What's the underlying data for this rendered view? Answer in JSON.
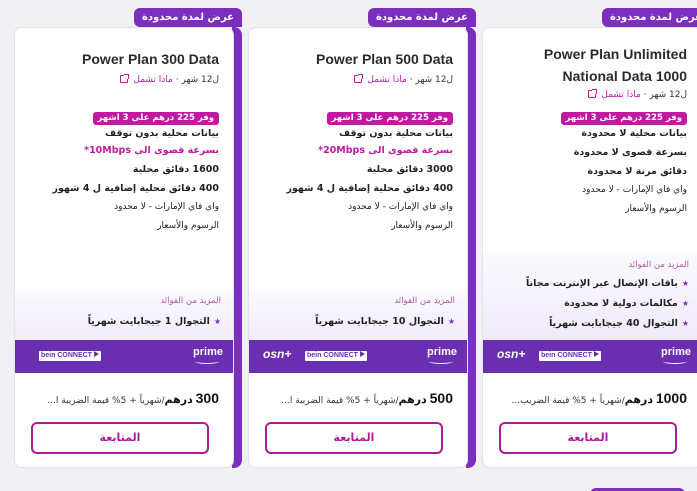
{
  "plans": [
    {
      "badge": "عرض لمدة محدودة",
      "title": "Power Plan 300 Data",
      "duration": "ل12 شهر ·",
      "whats_included": "ماذا تشمل",
      "save_label": "وفر 225 درهم على 3 اشهر",
      "features": [
        "بيانات محلية بدون توقف",
        "بسرعة قصوى الى 10Mbps*",
        "1600 دقائق محلية",
        "400 دقائق محلية إضافية ل 4 شهور",
        "واي فاي الإمارات - لا محدود",
        "الرسوم والأسعار"
      ],
      "benefits_label": "المزيد من الفوائد",
      "benefits": [
        "التجوال 1 جيجابايت شهرياً"
      ],
      "price_amount": "300",
      "price_currency": "درهم",
      "price_suffix": "/شهرياً + 5% قيمة الضريبة ا...",
      "cta_label": "المتابعة"
    },
    {
      "badge": "عرض لمدة محدودة",
      "title": "Power Plan 500 Data",
      "duration": "ل12 شهر ·",
      "whats_included": "ماذا تشمل",
      "save_label": "وفر 225 درهم على 3 اشهر",
      "features": [
        "بيانات محلية بدون توقف",
        "بسرعة قصوى الى 20Mbps*",
        "3000 دقائق محلية",
        "400 دقائق محلية إضافية ل 4 شهور",
        "واي فاي الإمارات - لا محدود",
        "الرسوم والأسعار"
      ],
      "benefits_label": "المزيد من الفوائد",
      "benefits": [
        "التجوال 10 جيجابايت شهرياً"
      ],
      "price_amount": "500",
      "price_currency": "درهم",
      "price_suffix": "/شهرياً + 5% قيمة الضريبة ا...",
      "cta_label": "المتابعة"
    },
    {
      "badge": "عرض لمدة محدودة",
      "title": "Power Plan Unlimited National Data 1000",
      "duration": "ل12 شهر ·",
      "whats_included": "ماذا تشمل",
      "save_label": "وفر 225 درهم على 3 اشهر",
      "features": [
        "بيانات محلية لا محدودة",
        "بسرعة قصوى لا محدودة",
        "دقائق مرنة لا محدودة",
        "واي فاي الإمارات - لا محدود",
        "الرسوم والأسعار"
      ],
      "benefits_label": "المزيد من الفوائد",
      "benefits": [
        "باقات الإتصال عبر الإنترنت مجاناً",
        "مكالمات دولية لا محدودة",
        "التجوال 40 جيجابايت شهرياً"
      ],
      "price_amount": "1000",
      "price_currency": "درهم",
      "price_suffix": "/شهرياً + 5% قيمة الضريب...",
      "cta_label": "المتابعة"
    }
  ],
  "ott": {
    "prime": "prime",
    "bein": "bein CONNECT",
    "osn": "osn+"
  },
  "icons": {
    "external_link": "external-link-icon",
    "star": "star-icon",
    "play": "play-icon"
  },
  "colors": {
    "brand_purple": "#7b2fbe",
    "accent_magenta": "#c01aa0",
    "ott_bar": "#6a2eb0"
  }
}
